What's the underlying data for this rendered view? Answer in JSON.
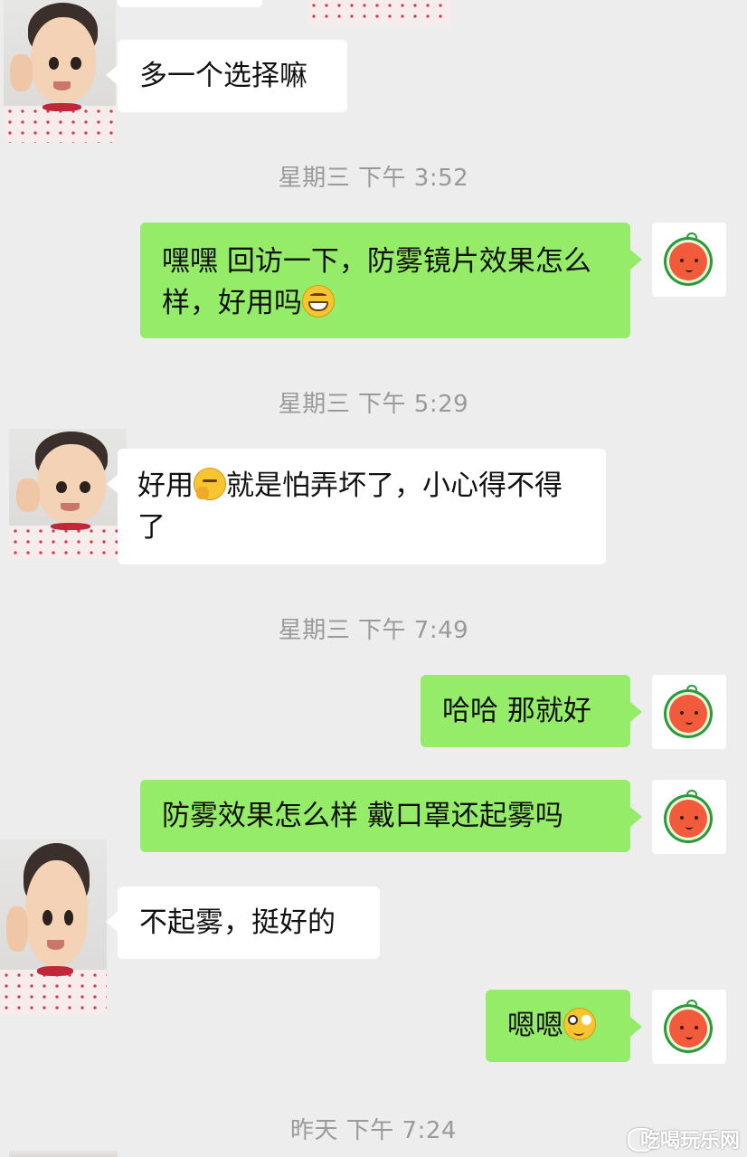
{
  "chat": {
    "messages": [
      {
        "side": "in",
        "text": "多一个选择嘛"
      },
      {
        "side": "out",
        "text": "嘿嘿 回访一下，防雾镜片效果怎么样，好用吗",
        "emoji": "grin-emoji"
      },
      {
        "side": "in",
        "text_a": "好用",
        "emoji": "thinking-emoji",
        "text_b": "就是怕弄坏了，小心得不得了"
      },
      {
        "side": "out",
        "text": "哈哈 那就好"
      },
      {
        "side": "out",
        "text": "防雾效果怎么样 戴口罩还起雾吗"
      },
      {
        "side": "in",
        "text": "不起雾，挺好的"
      },
      {
        "side": "out",
        "text": "嗯嗯",
        "emoji": "wide-eyes-emoji"
      }
    ],
    "timestamps": [
      "星期三 下午 3:52",
      "星期三 下午 5:29",
      "星期三 下午 7:49",
      "昨天 下午 7:24"
    ]
  },
  "colors": {
    "background": "#ededed",
    "incoming_bubble": "#ffffff",
    "outgoing_bubble": "#95ec69",
    "timestamp_text": "#9a9a9a"
  },
  "watermark": "吃喝玩乐网"
}
